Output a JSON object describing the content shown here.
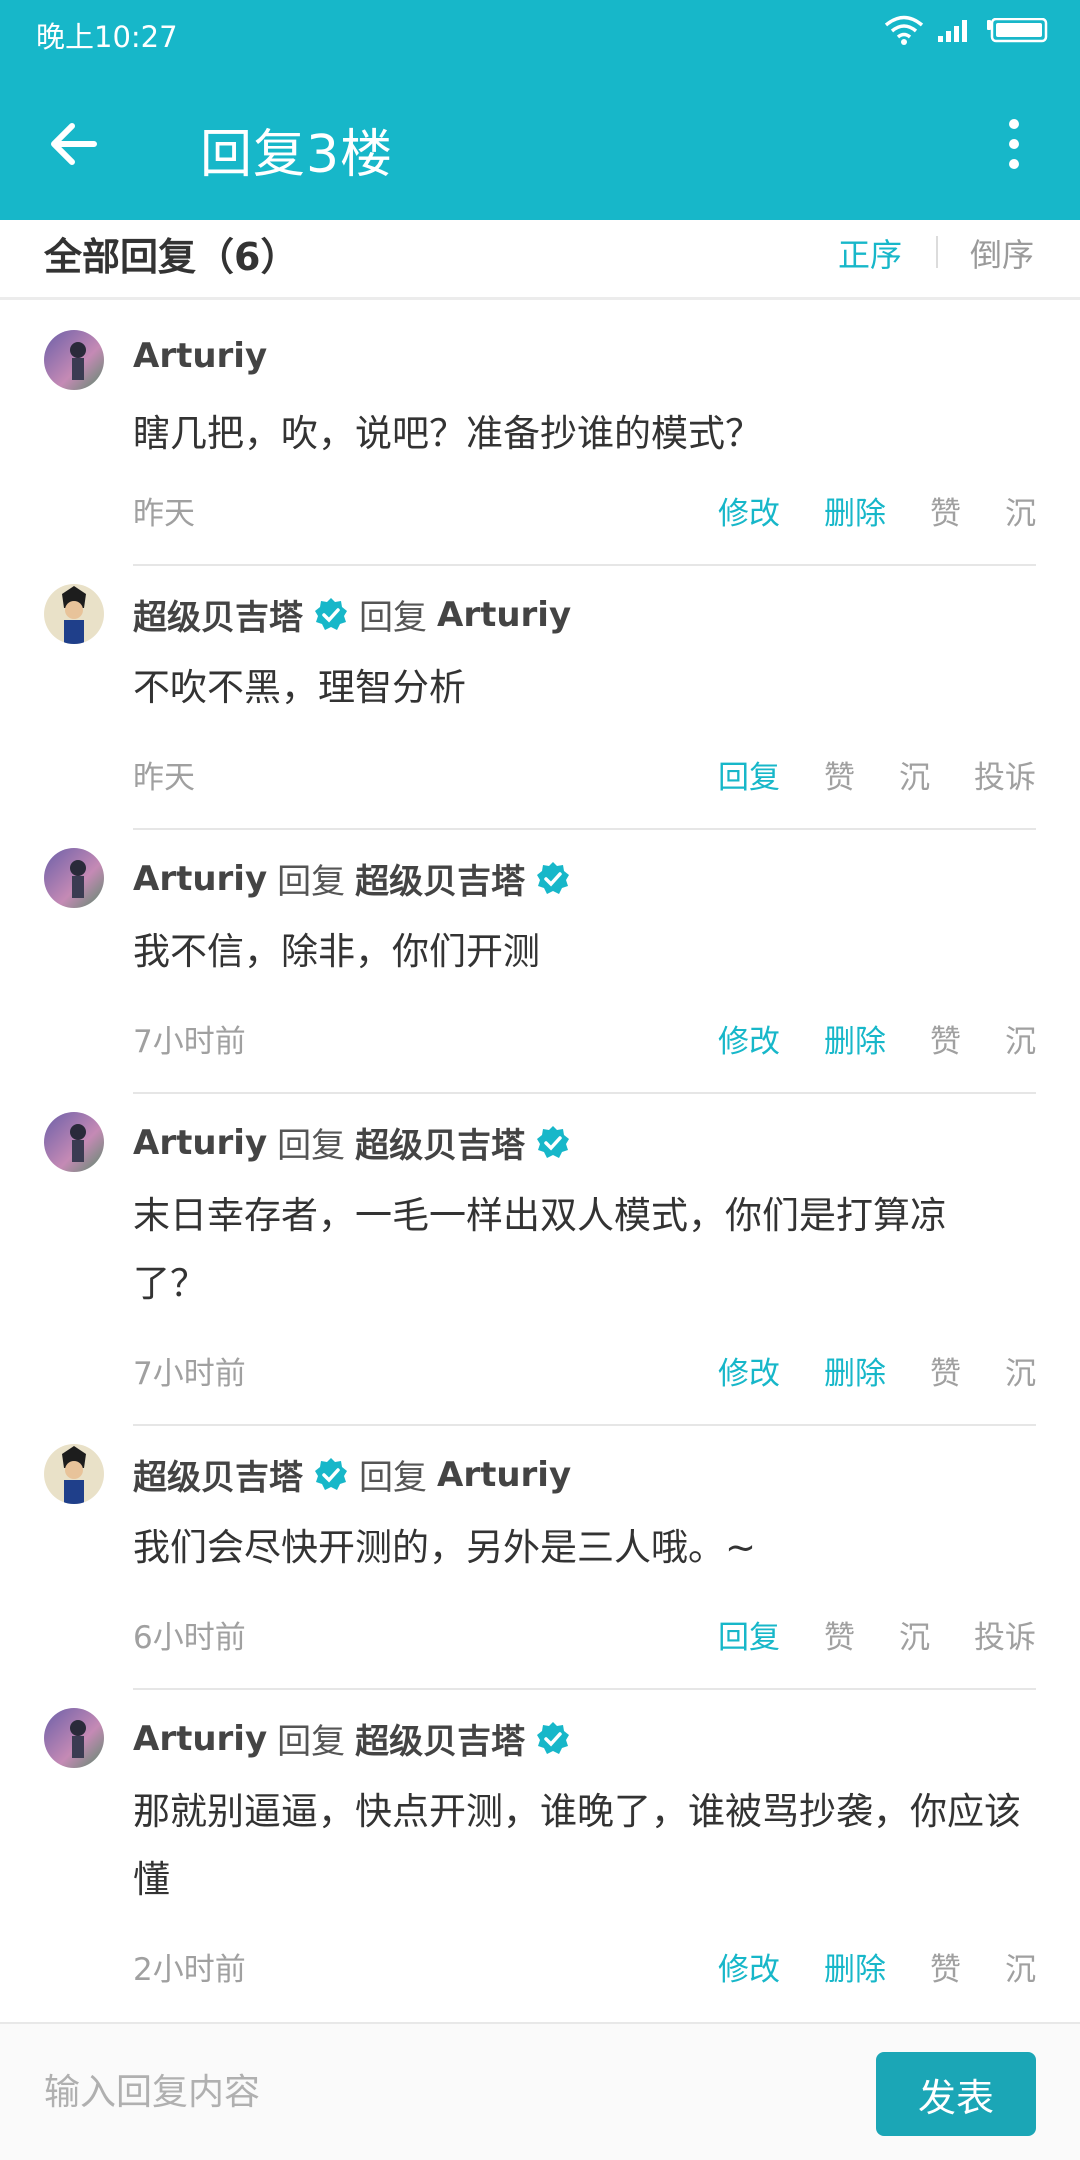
{
  "status_bar": {
    "time": "晚上10:27"
  },
  "app_bar": {
    "title": "回复3楼"
  },
  "sort_bar": {
    "count_label": "全部回复（6）",
    "asc": "正序",
    "desc": "倒序"
  },
  "replies": [
    {
      "author": "Arturiy",
      "reply_word": "",
      "target": "",
      "content": "瞎几把，吹，说吧？准备抄谁的模式？",
      "time": "昨天",
      "actions": [
        "修改",
        "删除",
        "赞",
        "沉"
      ]
    },
    {
      "author": "超级贝吉塔",
      "reply_word": "回复",
      "target": "Arturiy",
      "content": "不吹不黑，理智分析",
      "time": "昨天",
      "actions": [
        "回复",
        "赞",
        "沉",
        "投诉"
      ]
    },
    {
      "author": "Arturiy",
      "reply_word": "回复",
      "target": "超级贝吉塔",
      "content": "我不信，除非，你们开测",
      "time": "7小时前",
      "actions": [
        "修改",
        "删除",
        "赞",
        "沉"
      ]
    },
    {
      "author": "Arturiy",
      "reply_word": "回复",
      "target": "超级贝吉塔",
      "content": "末日幸存者，一毛一样出双人模式，你们是打算凉了？",
      "time": "7小时前",
      "actions": [
        "修改",
        "删除",
        "赞",
        "沉"
      ]
    },
    {
      "author": "超级贝吉塔",
      "reply_word": "回复",
      "target": "Arturiy",
      "content": "我们会尽快开测的，另外是三人哦。~",
      "time": "6小时前",
      "actions": [
        "回复",
        "赞",
        "沉",
        "投诉"
      ]
    },
    {
      "author": "Arturiy",
      "reply_word": "回复",
      "target": "超级贝吉塔",
      "content": "那就别逼逼，快点开测，谁晚了，谁被骂抄袭，你应该懂",
      "time": "2小时前",
      "actions": [
        "修改",
        "删除",
        "赞",
        "沉"
      ]
    }
  ],
  "input_bar": {
    "placeholder": "输入回复内容",
    "send_label": "发表"
  },
  "colors": {
    "accent": "#17b7c9",
    "send_button": "#1ba6b6"
  }
}
